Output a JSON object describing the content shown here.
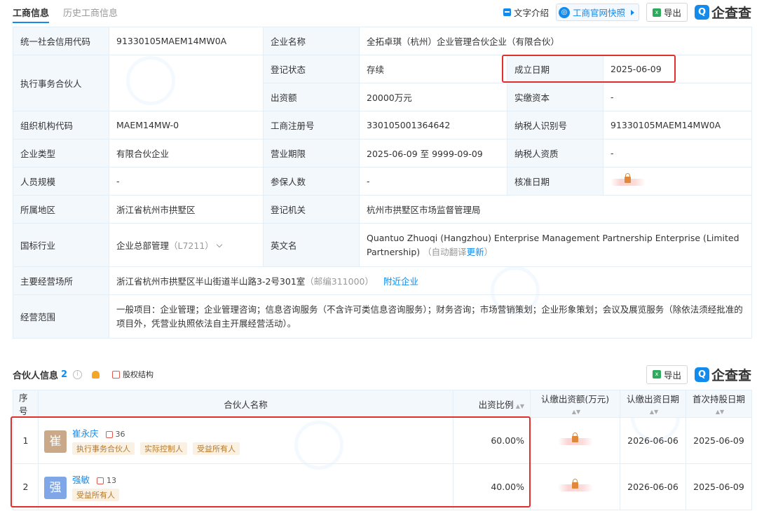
{
  "tabs": [
    "工商信息",
    "历史工商信息"
  ],
  "toolbar": {
    "text_intro": "文字介绍",
    "snapshot": "工商官网快照",
    "export": "导出",
    "logo": "企查查",
    "logo_mark": "Q"
  },
  "info": {
    "credit_code_label": "统一社会信用代码",
    "credit_code": "91330105MAEM14MW0A",
    "company_name_label": "企业名称",
    "company_name": "全拓卓琪（杭州）企业管理合伙企业（有限合伙）",
    "partner_label": "执行事务合伙人",
    "reg_status_label": "登记状态",
    "reg_status": "存续",
    "found_date_label": "成立日期",
    "found_date": "2025-06-09",
    "capital_label": "出资额",
    "capital": "20000万元",
    "paid_label": "实缴资本",
    "paid": "-",
    "org_code_label": "组织机构代码",
    "org_code": "MAEM14MW-0",
    "reg_no_label": "工商注册号",
    "reg_no": "330105001364642",
    "tax_id_label": "纳税人识别号",
    "tax_id": "91330105MAEM14MW0A",
    "type_label": "企业类型",
    "type": "有限合伙企业",
    "term_label": "营业期限",
    "term": "2025-06-09 至 9999-09-09",
    "tax_qual_label": "纳税人资质",
    "tax_qual": "-",
    "staff_label": "人员规模",
    "staff": "-",
    "insured_label": "参保人数",
    "insured": "-",
    "approve_label": "核准日期",
    "region_label": "所属地区",
    "region": "浙江省杭州市拱墅区",
    "authority_label": "登记机关",
    "authority": "杭州市拱墅区市场监督管理局",
    "industry_label": "国标行业",
    "industry": "企业总部管理",
    "industry_code": "（L7211）",
    "english_label": "英文名",
    "english": "Quantuo Zhuoqi (Hangzhou) Enterprise Management Partnership Enterprise (Limited Partnership)",
    "english_note_pre": "（自动翻译",
    "english_update": "更新",
    "english_note_post": "）",
    "address_label": "主要经营场所",
    "address": "浙江省杭州市拱墅区半山街道半山路3-2号301室",
    "postcode": "（邮编311000）",
    "nearby": "附近企业",
    "scope_label": "经营范围",
    "scope": "一般项目：企业管理；企业管理咨询；信息咨询服务（不含许可类信息咨询服务）；财务咨询；市场营销策划；企业形象策划；会议及展览服务（除依法须经批准的项目外，凭营业执照依法自主开展经营活动）。"
  },
  "partners_section": {
    "title": "合伙人信息",
    "count": "2",
    "info_icon": "i",
    "equity": "股权结构",
    "export": "导出",
    "logo": "企查查",
    "logo_mark": "Q",
    "columns": [
      "序号",
      "合伙人名称",
      "出资比例",
      "认缴出资额(万元)",
      "认缴出资日期",
      "首次持股日期"
    ],
    "rows": [
      {
        "no": "1",
        "avatar": "崔",
        "name": "崔永庆",
        "count": "36",
        "tags": [
          "执行事务合伙人",
          "实际控制人",
          "受益所有人"
        ],
        "ratio": "60.00%",
        "due_date": "2026-06-06",
        "first_date": "2025-06-09",
        "avatar_color": "#c9a98a"
      },
      {
        "no": "2",
        "avatar": "强",
        "name": "强敏",
        "count": "13",
        "tags": [
          "受益所有人"
        ],
        "ratio": "40.00%",
        "due_date": "2026-06-06",
        "first_date": "2025-06-09",
        "avatar_color": "#7fa6e6"
      }
    ]
  },
  "colors": {
    "accent": "#128bed",
    "highlight": "#e0302a"
  }
}
